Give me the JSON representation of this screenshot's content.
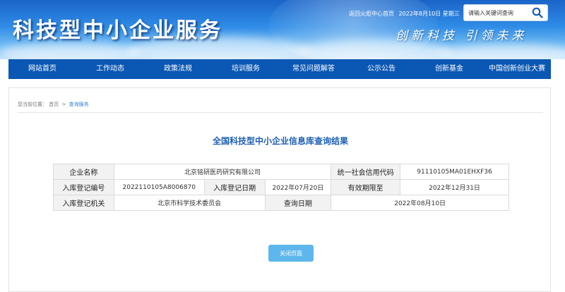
{
  "header": {
    "site_title": "科技型中小企业服务",
    "top_link_home": "返回火炬中心首页",
    "date_text": "2022年8月10日 星期三",
    "slogan": "创新科技  引领未来",
    "search_placeholder": "请输入关键词查询",
    "search_icon": "search-icon"
  },
  "nav": {
    "items": [
      "网站首页",
      "工作动态",
      "政策法规",
      "培训服务",
      "常见问题解答",
      "公示公告",
      "创新基金",
      "中国创新创业大赛"
    ]
  },
  "breadcrumb": {
    "prefix": "您当前位置：",
    "home": "首页",
    "separator": ">",
    "current": "查询服务"
  },
  "result": {
    "title": "全国科技型中小企业信息库查询结果",
    "rows": [
      {
        "label_company": "企业名称",
        "company": "北京铭研医药研究有限公司",
        "label_credit": "统一社会信用代码",
        "credit_code": "91110105MA01EHXF36"
      },
      {
        "label_reg_no": "入库登记编号",
        "reg_no": "2022110105A8006870",
        "label_reg_date": "入库登记日期",
        "reg_date": "2022年07月20日",
        "label_valid": "有效期限至",
        "valid_until": "2022年12月31日"
      },
      {
        "label_authority": "入库登记机关",
        "authority": "北京市科学技术委员会",
        "label_query_date": "查询日期",
        "query_date": "2022年08月10日"
      }
    ],
    "close_button": "关闭页面"
  },
  "colors": {
    "nav_bg": "#0a57b4",
    "title_color": "#1e5fb3",
    "button_bg": "#5eb7ec"
  }
}
